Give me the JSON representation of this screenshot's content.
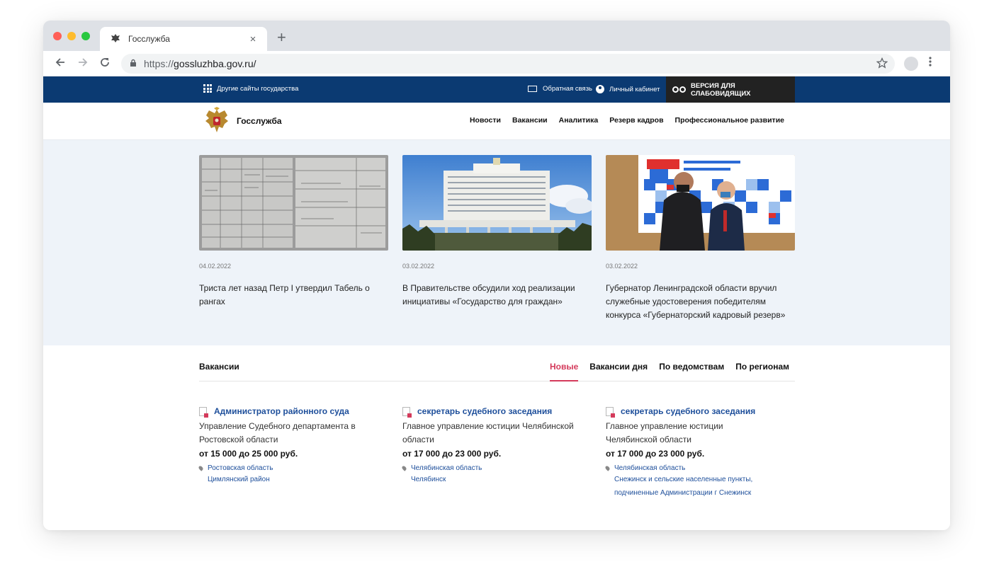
{
  "browser": {
    "tab_title": "Госслужба",
    "url_scheme": "https://",
    "url_host": "gossluzhba.gov.ru/",
    "new_tab_symbol": "+",
    "close_symbol": "×"
  },
  "topbar": {
    "other_sites": "Другие сайты государства",
    "feedback": "Обратная связь",
    "cabinet": "Личный кабинет",
    "vision_mode": "ВЕРСИЯ ДЛЯ СЛАБОВИДЯЩИХ"
  },
  "header": {
    "site_name": "Госслужба",
    "menu": [
      "Новости",
      "Вакансии",
      "Аналитика",
      "Резерв кадров",
      "Профессиональное развитие"
    ]
  },
  "news": [
    {
      "date": "04.02.2022",
      "title": "Триста лет назад Петр I утвердил Табель о рангах"
    },
    {
      "date": "03.02.2022",
      "title": "В Правительстве обсудили ход реализации инициативы «Государство для граждан»"
    },
    {
      "date": "03.02.2022",
      "title": "Губернатор Ленинградской области вручил служебные удостоверения победителям конкурса «Губернаторский кадровый резерв»"
    }
  ],
  "vacancies": {
    "label": "Вакансии",
    "tabs": [
      "Новые",
      "Вакансии дня",
      "По ведомствам",
      "По регионам"
    ],
    "items": [
      {
        "title": "Администратор районного суда",
        "org": "Управление Судебного департамента в Ростовской области",
        "salary": "от 15 000 до 25 000 руб.",
        "region": "Ростовская область",
        "district": "Цимлянский район"
      },
      {
        "title": "секретарь судебного заседания",
        "org": "Главное управление юстиции Челябинской области",
        "salary": "от 17 000 до 23 000 руб.",
        "region": "Челябинская область",
        "district": "Челябинск"
      },
      {
        "title": "секретарь судебного заседания",
        "org": "Главное управление юстиции Челябинской области",
        "salary": "от 17 000 до 23 000 руб.",
        "region": "Челябинская область",
        "district": "Снежинск и сельские населенные пункты, подчиненные Администрации г Снежинск"
      }
    ]
  },
  "colors": {
    "topbar_bg": "#0b3a72",
    "accent_red": "#d43a5b",
    "link_blue": "#1e4f9b",
    "news_bg": "#eef3f9"
  }
}
